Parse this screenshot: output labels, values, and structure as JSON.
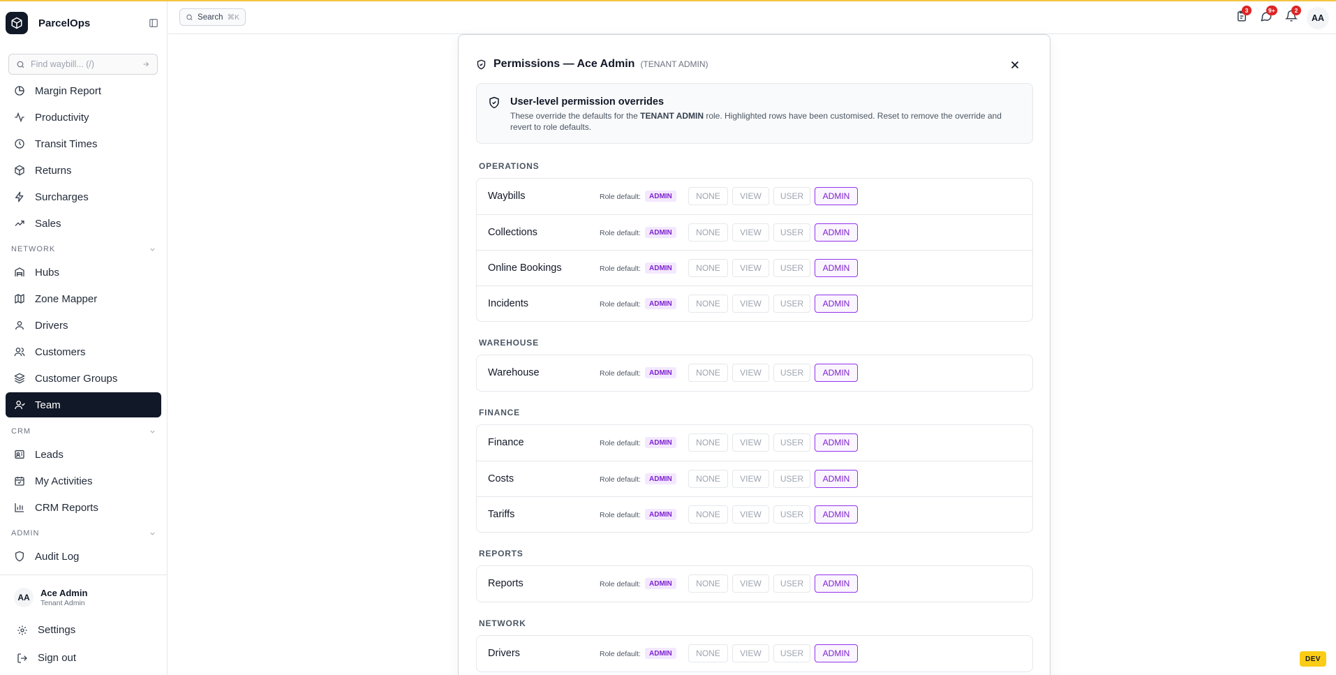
{
  "app": {
    "name": "ParcelOps"
  },
  "sidebar": {
    "find_placeholder": "Find waybill... (/)",
    "top_items": [
      {
        "label": "Margin Report",
        "icon": "pie-chart-icon"
      },
      {
        "label": "Productivity",
        "icon": "activity-icon"
      },
      {
        "label": "Transit Times",
        "icon": "clock-icon"
      },
      {
        "label": "Returns",
        "icon": "package-return-icon"
      },
      {
        "label": "Surcharges",
        "icon": "zap-icon"
      },
      {
        "label": "Sales",
        "icon": "trending-up-icon"
      }
    ],
    "sections": [
      {
        "title": "NETWORK",
        "items": [
          {
            "label": "Hubs",
            "icon": "warehouse-icon"
          },
          {
            "label": "Zone Mapper",
            "icon": "map-icon"
          },
          {
            "label": "Drivers",
            "icon": "user-icon"
          },
          {
            "label": "Customers",
            "icon": "users-icon"
          },
          {
            "label": "Customer Groups",
            "icon": "layers-icon"
          },
          {
            "label": "Team",
            "icon": "team-icon",
            "active": true
          }
        ]
      },
      {
        "title": "CRM",
        "items": [
          {
            "label": "Leads",
            "icon": "contact-icon"
          },
          {
            "label": "My Activities",
            "icon": "calendar-check-icon"
          },
          {
            "label": "CRM Reports",
            "icon": "bar-chart-icon"
          }
        ]
      },
      {
        "title": "ADMIN",
        "items": [
          {
            "label": "Audit Log",
            "icon": "shield-icon"
          }
        ]
      }
    ],
    "user": {
      "initials": "AA",
      "name": "Ace Admin",
      "role": "Tenant Admin"
    },
    "settings_label": "Settings",
    "signout_label": "Sign out"
  },
  "topbar": {
    "search_label": "Search",
    "search_shortcut": "⌘K",
    "badges": {
      "tasks": "3",
      "messages": "9+",
      "notifications": "2"
    },
    "avatar_initials": "AA"
  },
  "modal": {
    "title": "Permissions — Ace Admin",
    "subtitle": "(TENANT ADMIN)",
    "info": {
      "title": "User-level permission overrides",
      "body_pre": "These override the defaults for the ",
      "body_role": "TENANT ADMIN",
      "body_post": " role. Highlighted rows have been customised. Reset to remove the override and revert to role defaults."
    },
    "role_default_label": "Role default:",
    "levels": [
      "NONE",
      "VIEW",
      "USER",
      "ADMIN"
    ],
    "groups": [
      {
        "title": "OPERATIONS",
        "rows": [
          {
            "name": "Waybills",
            "default": "ADMIN",
            "selected": "ADMIN"
          },
          {
            "name": "Collections",
            "default": "ADMIN",
            "selected": "ADMIN"
          },
          {
            "name": "Online Bookings",
            "default": "ADMIN",
            "selected": "ADMIN"
          },
          {
            "name": "Incidents",
            "default": "ADMIN",
            "selected": "ADMIN"
          }
        ]
      },
      {
        "title": "WAREHOUSE",
        "rows": [
          {
            "name": "Warehouse",
            "default": "ADMIN",
            "selected": "ADMIN"
          }
        ]
      },
      {
        "title": "FINANCE",
        "rows": [
          {
            "name": "Finance",
            "default": "ADMIN",
            "selected": "ADMIN"
          },
          {
            "name": "Costs",
            "default": "ADMIN",
            "selected": "ADMIN"
          },
          {
            "name": "Tariffs",
            "default": "ADMIN",
            "selected": "ADMIN"
          }
        ]
      },
      {
        "title": "REPORTS",
        "rows": [
          {
            "name": "Reports",
            "default": "ADMIN",
            "selected": "ADMIN"
          }
        ]
      },
      {
        "title": "NETWORK",
        "rows": [
          {
            "name": "Drivers",
            "default": "ADMIN",
            "selected": "ADMIN"
          }
        ]
      }
    ]
  },
  "env_badge": "DEV",
  "colors": {
    "accent": "#9333ea",
    "accent_bg": "#faf5ff",
    "sidebar_active": "#111827",
    "badge": "#dc2626",
    "topline": "#f5c542",
    "env": "#facc15"
  }
}
